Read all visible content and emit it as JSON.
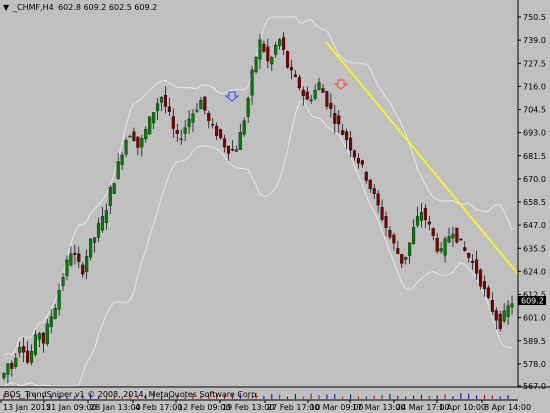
{
  "window": {
    "title": "_CHMF,H4",
    "ohlc": "602.8 609.2 602.5 609.2",
    "collapse_glyph": "▼"
  },
  "price_axis": {
    "labels": [
      "750.5",
      "739.0",
      "727.5",
      "716.0",
      "704.5",
      "693.0",
      "681.5",
      "670.0",
      "658.5",
      "647.0",
      "635.5",
      "624.0",
      "612.5",
      "601.0",
      "589.5",
      "578.0",
      "567.0"
    ],
    "current_price": "609.2"
  },
  "time_axis": {
    "labels": [
      "13 Jan 2015",
      "21 Jan 09:00",
      "28 Jan 13:00",
      "4 Feb 17:00",
      "12 Feb 09:00",
      "19 Feb 13:00",
      "27 Feb 17:00",
      "10 Mar 09:00",
      "17 Mar 13:00",
      "24 Mar 17:00",
      "1 Apr 10:00",
      "8 Apr 14:00"
    ]
  },
  "indicator": {
    "label": "BOS_TrendSniper v1 © 2008, 2014, MetaQuotes Software Corp."
  },
  "colors": {
    "background": "#c0c0c0",
    "up_candle": "#008000",
    "down_candle": "#800000",
    "band": "#e8e8e8",
    "trendline": "#ffff00",
    "price_box": "#000000",
    "buy_arrow": "#4040ff",
    "sell_arrow": "#ff4040"
  },
  "chart_data": {
    "type": "candlestick",
    "symbol": "_CHMF",
    "timeframe": "H4",
    "ylim": [
      567.0,
      750.5
    ],
    "close_path": [
      573,
      578,
      576,
      583,
      588,
      586,
      579,
      584,
      590,
      594,
      589,
      596,
      602,
      607,
      615,
      622,
      628,
      634,
      631,
      627,
      625,
      632,
      638,
      641,
      646,
      650,
      656,
      664,
      670,
      677,
      684,
      690,
      693,
      691,
      686,
      689,
      694,
      699,
      704,
      708,
      711,
      706,
      701,
      694,
      690,
      692,
      696,
      700,
      703,
      706,
      709,
      704,
      698,
      695,
      693,
      690,
      687,
      685,
      684,
      686,
      692,
      700,
      710,
      722,
      731,
      738,
      734,
      728,
      730,
      736,
      739,
      733,
      726,
      722,
      719,
      716,
      712,
      709,
      711,
      714,
      717,
      713,
      708,
      704,
      700,
      696,
      693,
      690,
      686,
      682,
      679,
      675,
      671,
      666,
      661,
      656,
      651,
      646,
      641,
      637,
      633,
      629,
      632,
      638,
      645,
      650,
      654,
      650,
      646,
      641,
      636,
      633,
      638,
      642,
      645,
      641,
      637,
      634,
      631,
      628,
      624,
      619,
      614,
      609,
      605,
      601,
      598,
      602,
      606,
      609
    ]
  }
}
